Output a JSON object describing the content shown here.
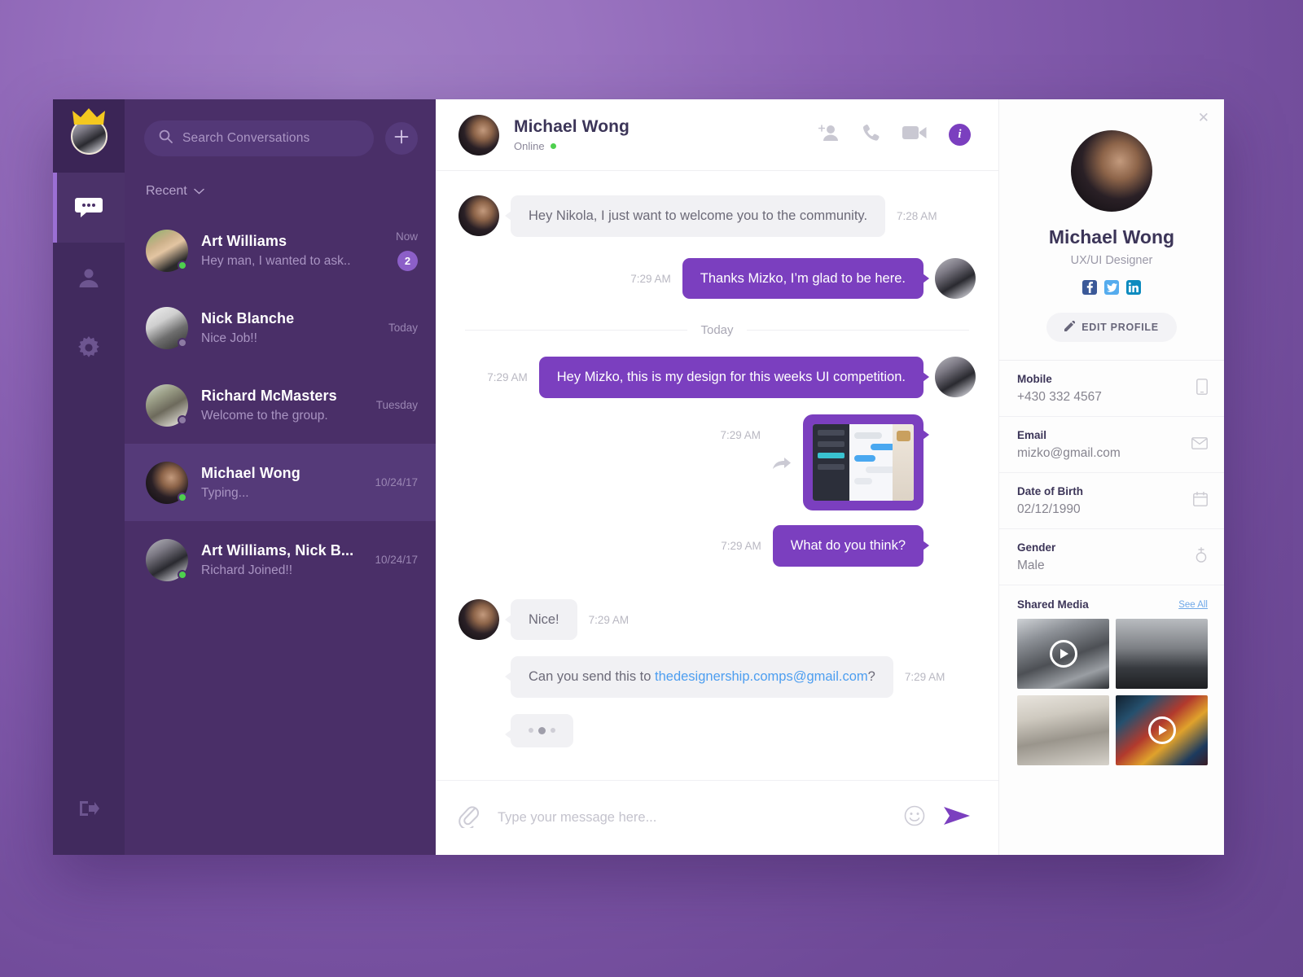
{
  "rail": {
    "logo_name": "user-crown-avatar",
    "items": [
      {
        "icon": "chat-bubble-icon",
        "name": "rail-item-messages",
        "active": true
      },
      {
        "icon": "contacts-icon",
        "name": "rail-item-contacts",
        "active": false
      },
      {
        "icon": "settings-gear-icon",
        "name": "rail-item-settings",
        "active": false
      }
    ],
    "logout": {
      "icon": "logout-icon",
      "name": "rail-item-logout"
    }
  },
  "conversations_panel": {
    "search": {
      "placeholder": "Search Conversations",
      "value": "",
      "icon": "search-icon"
    },
    "add_button_icon": "plus-icon",
    "sort_label": "Recent",
    "sort_icon": "chevron-down-icon",
    "items": [
      {
        "name": "Art Williams",
        "preview": "Hey man, I wanted to ask..",
        "time": "Now",
        "badge": "2",
        "presence": "online",
        "active": false,
        "avatar": "av-aw"
      },
      {
        "name": "Nick Blanche",
        "preview": "Nice Job!!",
        "time": "Today",
        "badge": "",
        "presence": "offline",
        "active": false,
        "avatar": "av-nk"
      },
      {
        "name": "Richard McMasters",
        "preview": "Welcome to the group.",
        "time": "Tuesday",
        "badge": "",
        "presence": "offline",
        "active": false,
        "avatar": "av-rm"
      },
      {
        "name": "Michael Wong",
        "preview": "Typing...",
        "time": "10/24/17",
        "badge": "",
        "presence": "online",
        "active": true,
        "avatar": "av-mw"
      },
      {
        "name": "Art Williams, Nick B...",
        "preview": "Richard Joined!!",
        "time": "10/24/17",
        "badge": "",
        "presence": "online",
        "active": false,
        "avatar": "av-me"
      }
    ]
  },
  "chat": {
    "header": {
      "name": "Michael Wong",
      "status": "Online",
      "actions": [
        {
          "icon": "add-person-icon",
          "name": "add-person-button"
        },
        {
          "icon": "phone-icon",
          "name": "voice-call-button"
        },
        {
          "icon": "video-camera-icon",
          "name": "video-call-button"
        },
        {
          "icon": "info-icon",
          "name": "info-button",
          "label": "i"
        }
      ]
    },
    "date_divider": "Today",
    "messages": [
      {
        "id": "m1",
        "side": "in",
        "type": "text",
        "text": "Hey Nikola, I just want to welcome you to the community.",
        "time": "7:28 AM",
        "avatar": true
      },
      {
        "id": "m2",
        "side": "out",
        "type": "text",
        "text": "Thanks Mizko, I’m glad to be here.",
        "time": "7:29 AM",
        "avatar": true
      },
      {
        "id": "m3",
        "side": "out",
        "type": "text",
        "text": "Hey Mizko, this is my design for this weeks UI competition.",
        "time": "7:29 AM",
        "avatar": true
      },
      {
        "id": "m4",
        "side": "out",
        "type": "image",
        "text": "",
        "time": "7:29 AM",
        "avatar": false,
        "forward_icon": "forward-arrow-icon"
      },
      {
        "id": "m5",
        "side": "out",
        "type": "text",
        "text": "What do you think?",
        "time": "7:29 AM",
        "avatar": false
      },
      {
        "id": "m6",
        "side": "in",
        "type": "text",
        "text": "Nice!",
        "time": "7:29 AM",
        "avatar": true
      },
      {
        "id": "m7",
        "side": "in",
        "type": "link",
        "text_before": "Can you send this to ",
        "link_text": "thedesignership.comps@gmail.com",
        "text_after": "?",
        "time": "7:29 AM",
        "avatar": false
      },
      {
        "id": "m8",
        "side": "in",
        "type": "typing",
        "text": "",
        "time": "",
        "avatar": false
      }
    ],
    "composer": {
      "attach_icon": "paperclip-icon",
      "placeholder": "Type your message here...",
      "value": "",
      "emoji_icon": "smiley-icon",
      "send_icon": "send-arrow-icon"
    }
  },
  "profile": {
    "close_icon": "close-icon",
    "name": "Michael Wong",
    "role": "UX/UI Designer",
    "socials": [
      {
        "name": "facebook-icon",
        "color": "#3b5998"
      },
      {
        "name": "twitter-icon",
        "color": "#55acee"
      },
      {
        "name": "linkedin-icon",
        "color": "#0c8bbf"
      }
    ],
    "edit_button": {
      "label": "EDIT PROFILE",
      "icon": "edit-pencil-icon"
    },
    "fields": [
      {
        "label": "Mobile",
        "value": "+430 332 4567",
        "icon": "mobile-phone-icon"
      },
      {
        "label": "Email",
        "value": "mizko@gmail.com",
        "icon": "envelope-icon"
      },
      {
        "label": "Date of Birth",
        "value": "02/12/1990",
        "icon": "calendar-icon"
      },
      {
        "label": "Gender",
        "value": "Male",
        "icon": "gender-male-icon"
      }
    ],
    "shared_media": {
      "title": "Shared Media",
      "see_all": "See All",
      "items": [
        {
          "name": "media-temple-video",
          "style": "ph-a",
          "video": true
        },
        {
          "name": "media-dome-photo",
          "style": "ph-b",
          "video": false
        },
        {
          "name": "media-person-photo",
          "style": "ph-c",
          "video": false
        },
        {
          "name": "media-city-video",
          "style": "ph-d",
          "video": true
        }
      ]
    }
  },
  "colors": {
    "accent_purple": "#7b3fbf",
    "rail_bg": "#412a5e",
    "conv_bg": "#4a2f68",
    "conv_active": "#553a79",
    "online_green": "#4ed04e",
    "link_blue": "#4d9ef0"
  }
}
